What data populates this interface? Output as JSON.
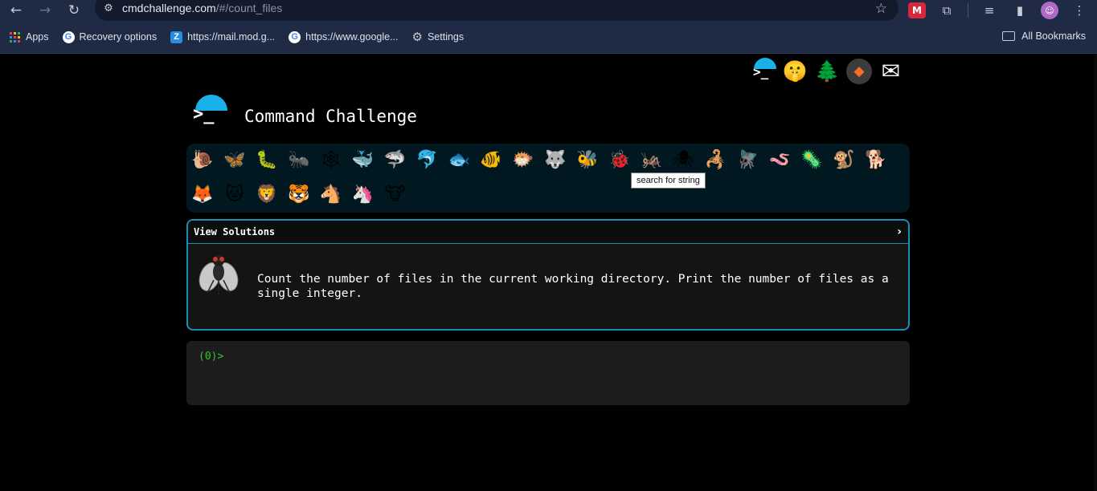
{
  "browser": {
    "url_host": "cmdchallenge.com",
    "url_path": "/#/count_files",
    "bookmarks": [
      {
        "label": "Apps",
        "icon": "apps-grid-icon"
      },
      {
        "label": "Recovery options",
        "icon": "google-icon"
      },
      {
        "label": "https://mail.mod.g...",
        "icon": "zimbra-icon"
      },
      {
        "label": "https://www.google...",
        "icon": "google-icon"
      },
      {
        "label": "Settings",
        "icon": "gear-icon"
      }
    ],
    "all_bookmarks_label": "All Bookmarks"
  },
  "header": {
    "title": "Command Challenge",
    "links": [
      "cmdchallenge-logo",
      "hint-emoji",
      "tree-emoji",
      "gitlab-icon",
      "mail-icon"
    ]
  },
  "levels": {
    "items": [
      {
        "glyph": "🐌",
        "name": "snail"
      },
      {
        "glyph": "🦋",
        "name": "butterfly"
      },
      {
        "glyph": "🐛",
        "name": "caterpillar"
      },
      {
        "glyph": "🐜",
        "name": "ant"
      },
      {
        "glyph": "🕸",
        "name": "spiderweb"
      },
      {
        "glyph": "🐳",
        "name": "whale"
      },
      {
        "glyph": "🦈",
        "name": "shark"
      },
      {
        "glyph": "🐬",
        "name": "dolphin"
      },
      {
        "glyph": "🐟",
        "name": "fish"
      },
      {
        "glyph": "🐠",
        "name": "tropical-fish"
      },
      {
        "glyph": "🐡",
        "name": "blowfish"
      },
      {
        "glyph": "🐺",
        "name": "wolf"
      },
      {
        "glyph": "🐝",
        "name": "bee"
      },
      {
        "glyph": "🐞",
        "name": "ladybug"
      },
      {
        "glyph": "🦗",
        "name": "cricket"
      },
      {
        "glyph": "🕷",
        "name": "spider"
      },
      {
        "glyph": "🦂",
        "name": "scorpion"
      },
      {
        "glyph": "🪰",
        "name": "fly"
      },
      {
        "glyph": "🪱",
        "name": "worm"
      },
      {
        "glyph": "🦠",
        "name": "microbe"
      },
      {
        "glyph": "🐒",
        "name": "monkey"
      },
      {
        "glyph": "🐕",
        "name": "dog"
      },
      {
        "glyph": "🦊",
        "name": "fox"
      },
      {
        "glyph": "🐱",
        "name": "cat"
      },
      {
        "glyph": "🦁",
        "name": "lion"
      },
      {
        "glyph": "🐯",
        "name": "tiger"
      },
      {
        "glyph": "🐴",
        "name": "horse"
      },
      {
        "glyph": "🦄",
        "name": "unicorn"
      },
      {
        "glyph": "🐮",
        "name": "cow"
      }
    ],
    "tooltip": "search for string"
  },
  "challenge": {
    "header_label": "View Solutions",
    "description": "Count the number of files in the current working directory. Print the number of files as a single integer.",
    "icon": "fly-icon"
  },
  "terminal": {
    "prompt": "(0)>"
  },
  "colors": {
    "accent": "#1ab0e8",
    "border": "#1b8fb3",
    "prompt_green": "#2fc52f",
    "levels_bg": "#011820"
  }
}
